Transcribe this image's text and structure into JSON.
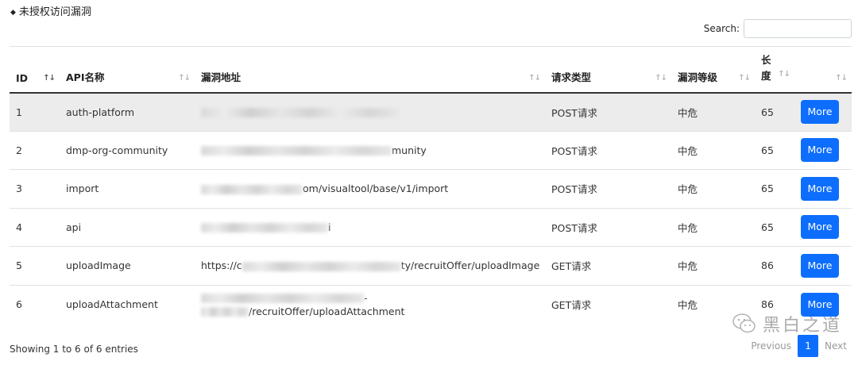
{
  "section": {
    "bullet": "◆",
    "title": "未授权访问漏洞"
  },
  "search": {
    "label": "Search:",
    "value": "",
    "placeholder": ""
  },
  "table": {
    "headers": [
      {
        "label": "ID",
        "sort": "↑↓"
      },
      {
        "label": "API名称",
        "sort": "↑↓"
      },
      {
        "label": "漏洞地址",
        "sort": "↑↓"
      },
      {
        "label": "请求类型",
        "sort": "↑↓"
      },
      {
        "label": "漏洞等级",
        "sort": "↑↓"
      },
      {
        "label": "长度",
        "sort": "↑↓"
      },
      {
        "label": "",
        "sort": "↑↓"
      }
    ],
    "rows": [
      {
        "id": "1",
        "api": "auth-platform",
        "url_line1": "",
        "url_line2": "",
        "method": "POST请求",
        "level": "中危",
        "length": "65",
        "action": "More"
      },
      {
        "id": "2",
        "api": "dmp-org-community",
        "url_line1": "munity",
        "url_line2": "",
        "method": "POST请求",
        "level": "中危",
        "length": "65",
        "action": "More"
      },
      {
        "id": "3",
        "api": "import",
        "url_line1": "om/visualtool/base/v1/import",
        "url_line2": "",
        "method": "POST请求",
        "level": "中危",
        "length": "65",
        "action": "More"
      },
      {
        "id": "4",
        "api": "api",
        "url_line1": "i",
        "url_line2": "",
        "method": "POST请求",
        "level": "中危",
        "length": "65",
        "action": "More"
      },
      {
        "id": "5",
        "api": "uploadImage",
        "url_line1": "https://c",
        "url_line1_suffix": "ty/recruitOffer/uploadImage",
        "url_line2": "",
        "method": "GET请求",
        "level": "中危",
        "length": "86",
        "action": "More"
      },
      {
        "id": "6",
        "api": "uploadAttachment",
        "url_line1": "-",
        "url_line2": "/recruitOffer/uploadAttachment",
        "method": "GET请求",
        "level": "中危",
        "length": "86",
        "action": "More"
      }
    ]
  },
  "footer": {
    "showing": "Showing 1 to 6 of 6 entries"
  },
  "pagination": {
    "prev": "Previous",
    "current": "1",
    "next": "Next"
  },
  "watermark": {
    "text": "黑白之道",
    "icon": "wechat-icon"
  },
  "colors": {
    "primary": "#0d6efd",
    "active_row": "#ececec",
    "border": "#dee2e6"
  }
}
